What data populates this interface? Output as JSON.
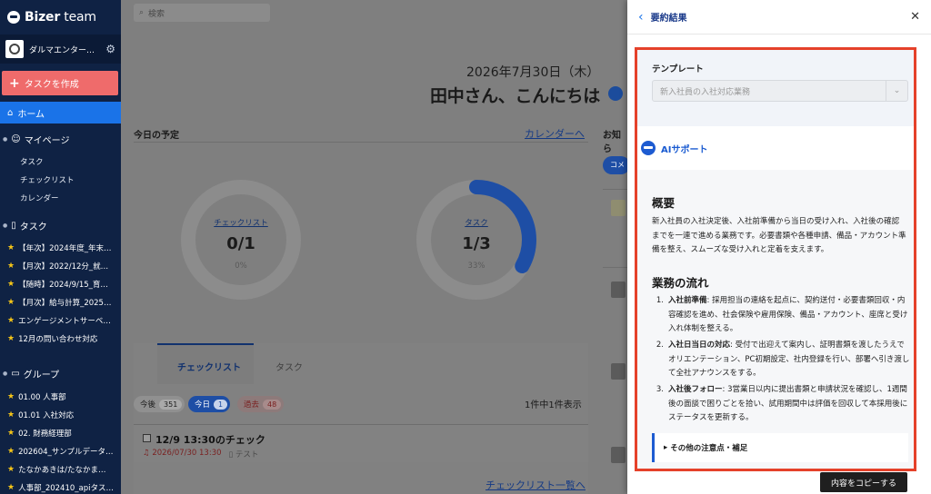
{
  "sidebar": {
    "brand": "Bizer",
    "brand_suffix": " team",
    "org_name": "ダルマエンター…",
    "create_button": "タスクを作成",
    "home": "ホーム",
    "mypage": "マイページ",
    "mypage_items": [
      "タスク",
      "チェックリスト",
      "カレンダー"
    ],
    "tasks_section": "タスク",
    "task_items": [
      "【年次】2024年度_年末…",
      "【月次】2022/12分_就…",
      "【随時】2024/9/15_育…",
      "【月次】給与計算_2025…",
      "エンゲージメントサーベ…",
      "12月の問い合わせ対応"
    ],
    "groups_section": "グループ",
    "group_items": [
      "01.00 人事部",
      "01.01 入社対応",
      "02. 財務経理部",
      "202604_サンプルデータ…",
      "たなかあきは/たなかま…",
      "人事部_202410_apiタス…"
    ]
  },
  "main": {
    "search_placeholder": "検索",
    "date": "2026年7月30日（木）",
    "greeting": "田中さん、こんにちは",
    "today_schedule": "今日の予定",
    "calendar_link": "カレンダーへ",
    "notice_title": "お知ら",
    "checklist_donut": {
      "label": "チェックリスト",
      "value": "0/1",
      "percent": "0%",
      "fraction": 0
    },
    "task_donut": {
      "label": "タスク",
      "value": "1/3",
      "percent": "33%",
      "fraction": 0.333
    },
    "tabs": [
      "チェックリスト",
      "タスク"
    ],
    "chips": [
      {
        "label": "今後",
        "count": "351"
      },
      {
        "label": "今日",
        "count": "1"
      },
      {
        "label": "過去",
        "count": "48"
      }
    ],
    "count_text": "1件中1件表示",
    "task_item": {
      "title": "12/9 13:30のチェック",
      "datetime": "2026/07/30 13:30",
      "tag": "テスト"
    },
    "list_link": "チェックリスト一覧へ",
    "right_pill": "コメ"
  },
  "drawer": {
    "title": "要約結果",
    "template_label": "テンプレート",
    "template_value": "新入社員の入社対応業務",
    "ai_label": "AIサポート",
    "overview_heading": "概要",
    "overview_text": "新入社員の入社決定後、入社前準備から当日の受け入れ、入社後の確認までを一連で進める業務です。必要書類や各種申請、備品・アカウント準備を整え、スムーズな受け入れと定着を支えます。",
    "flow_heading": "業務の流れ",
    "flow": [
      {
        "num": "1.",
        "title": "入社前準備",
        "text": ": 採用担当の連絡を起点に、契約送付・必要書類回収・内容確認を進め、社会保険や雇用保険、備品・アカウント、座席と受け入れ体制を整える。"
      },
      {
        "num": "2.",
        "title": "入社日当日の対応",
        "text": ": 受付で出迎えて案内し、証明書類を渡したうえでオリエンテーション、PC初期設定、社内登録を行い、部署へ引き渡して全社アナウンスをする。"
      },
      {
        "num": "3.",
        "title": "入社後フォロー",
        "text": ": 3営業日以内に提出書類と申請状況を確認し、1週間後の面談で困りごとを拾い、試用期間中は評価を回収して本採用後にステータスを更新する。"
      }
    ],
    "notes_label": "その他の注意点・補足",
    "copy_button": "内容をコピーする"
  }
}
